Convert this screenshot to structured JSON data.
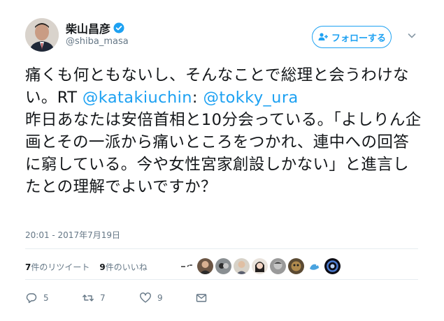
{
  "author": {
    "name": "柴山昌彦",
    "handle": "@shiba_masa"
  },
  "follow_button": {
    "label": "フォローする"
  },
  "tweet": {
    "part1": "痛くも何ともないし、そんなことで総理と会うわけない。RT ",
    "mention1": "@katakiuchin",
    "part2": ": ",
    "mention2": "@tokky_ura",
    "part3": "\n昨日あなたは安倍首相と10分会っている。「よしりん企画とその一派から痛いところをつかれ、連中への回答に窮している。今や女性宮家創設しかない」と進言したとの理解でよいですか？"
  },
  "timestamp": "20:01 - 2017年7月19日",
  "stats": {
    "retweets_count": "7",
    "retweets_label": "件のリツイート",
    "likes_count": "9",
    "likes_label": "件のいいね"
  },
  "actions": {
    "reply_count": "5",
    "retweet_count": "7",
    "like_count": "9"
  },
  "colors": {
    "accent": "#1da1f2",
    "text": "#14171a",
    "secondary": "#657786",
    "divider": "#e6ecf0"
  },
  "icons": [
    "verified-badge-icon",
    "follow-person-icon",
    "chevron-down-icon",
    "reply-icon",
    "retweet-icon",
    "like-icon",
    "direct-message-icon"
  ]
}
